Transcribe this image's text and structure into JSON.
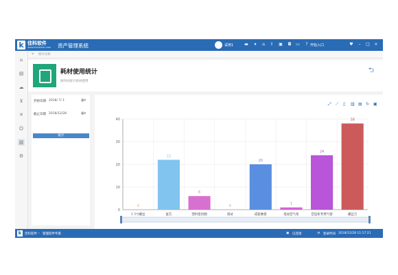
{
  "topbar": {
    "brand": "佳科软件",
    "brand_sub": "www.shareaotl.com",
    "system_name": "资产管理系统",
    "user_name": "试用1",
    "exit_label": "开始入口",
    "icons": [
      "menu-icon",
      "home-icon",
      "upload-icon",
      "print-icon",
      "save-icon",
      "display-icon",
      "help-icon",
      "heart-icon",
      "minimize-icon",
      "maximize-icon",
      "close-icon"
    ]
  },
  "sidebar": {
    "icons": [
      "home-icon",
      "document-icon",
      "cloud-icon",
      "cart-icon",
      "tools-icon",
      "user-icon",
      "chart-icon",
      "settings-icon"
    ]
  },
  "breadcrumb": {
    "text": "统计分析"
  },
  "header": {
    "title": "耗材使用统计",
    "subtitle": "按时间统计耗材使用"
  },
  "filter": {
    "start_label": "开始日期",
    "start_value": "2018/ 7/ 1",
    "end_label": "截止日期",
    "end_value": "2018/12/28",
    "button_label": "统计"
  },
  "toolbar_icons": [
    "zoom-icon",
    "line-icon",
    "rect-icon",
    "bar-icon",
    "stack-icon",
    "refresh-icon",
    "save-image-icon"
  ],
  "chart_data": {
    "type": "bar",
    "categories": [
      "1 5寸螺丝",
      "复方",
      "塑料密封圈",
      "测试",
      "成套乘客",
      "电动空气泵",
      "空压机专用气管",
      "螺丝刀"
    ],
    "values": [
      0,
      22,
      6,
      0,
      20,
      1,
      24,
      38
    ],
    "data_labels": [
      "0",
      "22",
      "6",
      "0",
      "20",
      "1",
      "24",
      "38"
    ],
    "colors": [
      "#f0a070",
      "#82c4f0",
      "#d870d0",
      "#7ec89c",
      "#5a8ee0",
      "#d860d8",
      "#b855d8",
      "#cc5a5a"
    ],
    "ylim": [
      0,
      40
    ],
    "yticks": [
      "0",
      "10",
      "20",
      "30",
      "40"
    ],
    "grid": true
  },
  "statusbar": {
    "left": "佳科软件",
    "path": "管理软件专家",
    "status": "已连接",
    "time_label": "登录时间",
    "time_value": "2018/12/28 11:17:21"
  }
}
